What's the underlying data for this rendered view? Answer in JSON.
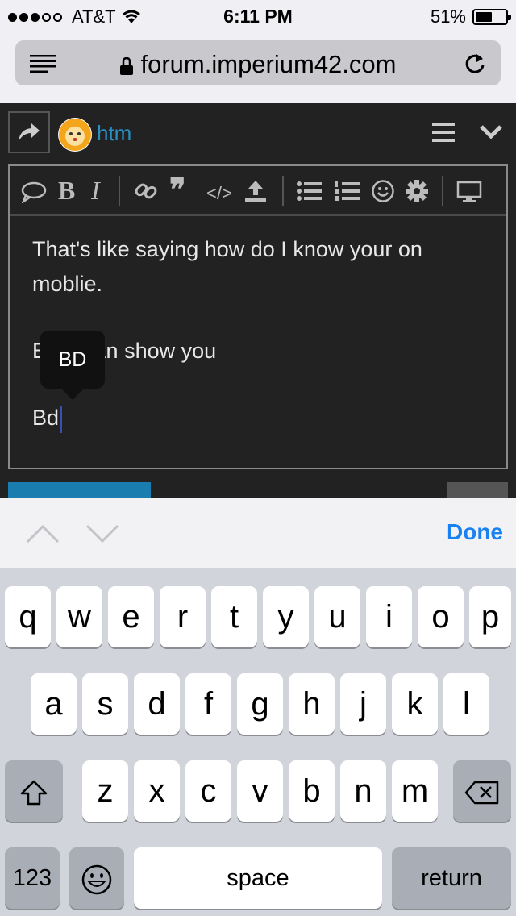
{
  "status_bar": {
    "carrier": "AT&T",
    "time": "6:11 PM",
    "battery": "51%",
    "battery_level": 0.51,
    "signal_bars": 3,
    "signal_total": 5
  },
  "browser": {
    "url": "forum.imperium42.com",
    "menu_icon": "reader-icon",
    "reload_icon": "reload-icon"
  },
  "forum": {
    "username": "htm",
    "username_color": "#2a8fc4"
  },
  "editor": {
    "toolbar": [
      {
        "name": "quote-bubble-icon",
        "glyph": "💬"
      },
      {
        "name": "bold-icon",
        "glyph": "B"
      },
      {
        "name": "italic-icon",
        "glyph": "I"
      },
      {
        "name": "link-icon",
        "glyph": "🔗"
      },
      {
        "name": "blockquote-icon",
        "glyph": "❞"
      },
      {
        "name": "code-icon",
        "glyph": "</>"
      },
      {
        "name": "upload-icon",
        "glyph": "⤒"
      },
      {
        "name": "bullet-list-icon",
        "glyph": "☰"
      },
      {
        "name": "numbered-list-icon",
        "glyph": "☷"
      },
      {
        "name": "emoji-icon",
        "glyph": "☺"
      },
      {
        "name": "gear-icon",
        "glyph": "⚙"
      },
      {
        "name": "preview-icon",
        "glyph": "🖥"
      }
    ],
    "paragraphs": [
      "That's like saying how do I know your on moblie.",
      "But I can show you",
      "Bd"
    ],
    "tooltip": "BD"
  },
  "accessory": {
    "done_label": "Done"
  },
  "keyboard": {
    "row1": [
      "q",
      "w",
      "e",
      "r",
      "t",
      "y",
      "u",
      "i",
      "o",
      "p"
    ],
    "row2": [
      "a",
      "s",
      "d",
      "f",
      "g",
      "h",
      "j",
      "k",
      "l"
    ],
    "row3": [
      "z",
      "x",
      "c",
      "v",
      "b",
      "n",
      "m"
    ],
    "numbers_label": "123",
    "space_label": "space",
    "return_label": "return"
  }
}
